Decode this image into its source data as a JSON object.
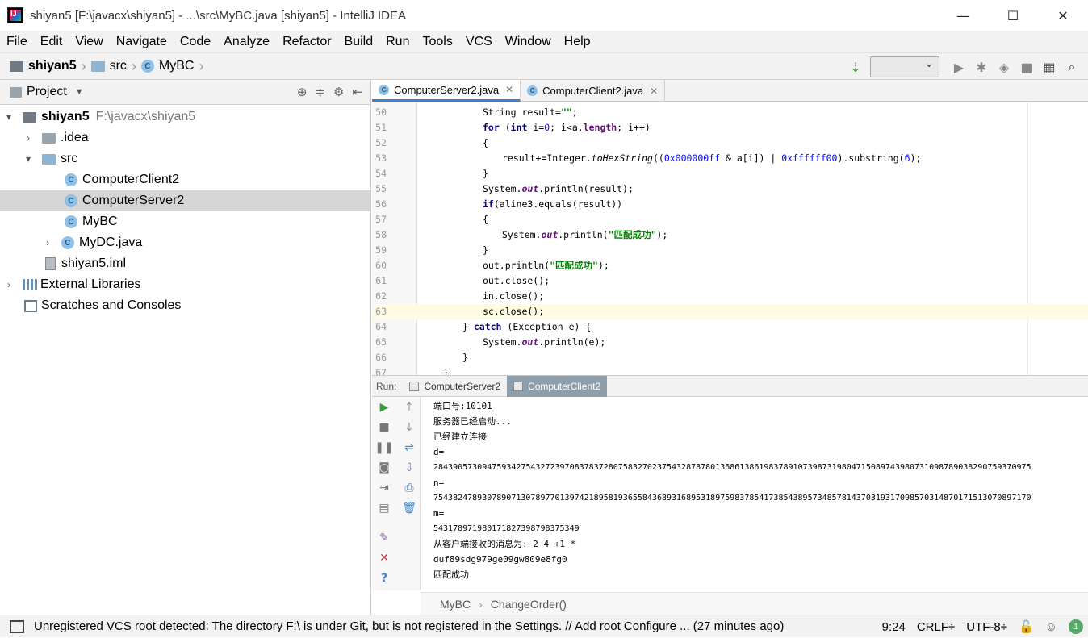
{
  "window": {
    "title": "shiyan5 [F:\\javacx\\shiyan5] - ...\\src\\MyBC.java [shiyan5] - IntelliJ IDEA",
    "minimize": "—",
    "maximize": "☐",
    "close": "✕"
  },
  "menu": [
    "File",
    "Edit",
    "View",
    "Navigate",
    "Code",
    "Analyze",
    "Refactor",
    "Build",
    "Run",
    "Tools",
    "VCS",
    "Window",
    "Help"
  ],
  "navbar": {
    "crumbs": [
      "shiyan5",
      "src",
      "MyBC"
    ]
  },
  "project": {
    "title": "Project",
    "tree": [
      {
        "label": "shiyan5",
        "extra": "F:\\javacx\\shiyan5"
      },
      {
        "label": ".idea"
      },
      {
        "label": "src"
      },
      {
        "label": "ComputerClient2"
      },
      {
        "label": "ComputerServer2"
      },
      {
        "label": "MyBC"
      },
      {
        "label": "MyDC.java"
      },
      {
        "label": "shiyan5.iml"
      },
      {
        "label": "External Libraries"
      },
      {
        "label": "Scratches and Consoles"
      }
    ]
  },
  "editor": {
    "tabs": [
      "ComputerServer2.java",
      "ComputerClient2.java"
    ],
    "line_numbers": [
      "50",
      "51",
      "52",
      "53",
      "54",
      "55",
      "56",
      "57",
      "58",
      "59",
      "60",
      "61",
      "62",
      "63",
      "64",
      "65",
      "66",
      "67"
    ]
  },
  "run": {
    "label": "Run:",
    "tabs": [
      "ComputerServer2",
      "ComputerClient2"
    ],
    "output": [
      "端口号:10101",
      "服务器已经启动...",
      "已经建立连接",
      "d=",
      "284390573094759342754327239708378372807583270237543287878013686138619837891073987319804715089743980731098789038290759370975",
      "n=",
      "754382478930789071307897701397421895819365584368931689531897598378541738543895734857814370319317098570314870171513070897170",
      "m=",
      "5431789719801718273987983753​49",
      "从客户端接收的消息为: 2 4 +1 *",
      "duf89sdg979ge09gw809e8fg0",
      "匹配成功"
    ],
    "breadcrumb": [
      "MyBC",
      "ChangeOrder()"
    ]
  },
  "status": {
    "message": "Unregistered VCS root detected: The directory F:\\ is under Git, but is not registered in the Settings. // Add root  Configure ... (27 minutes ago)",
    "position": "9:24",
    "line_sep": "CRLF",
    "encoding": "UTF-8",
    "badge": "1"
  }
}
